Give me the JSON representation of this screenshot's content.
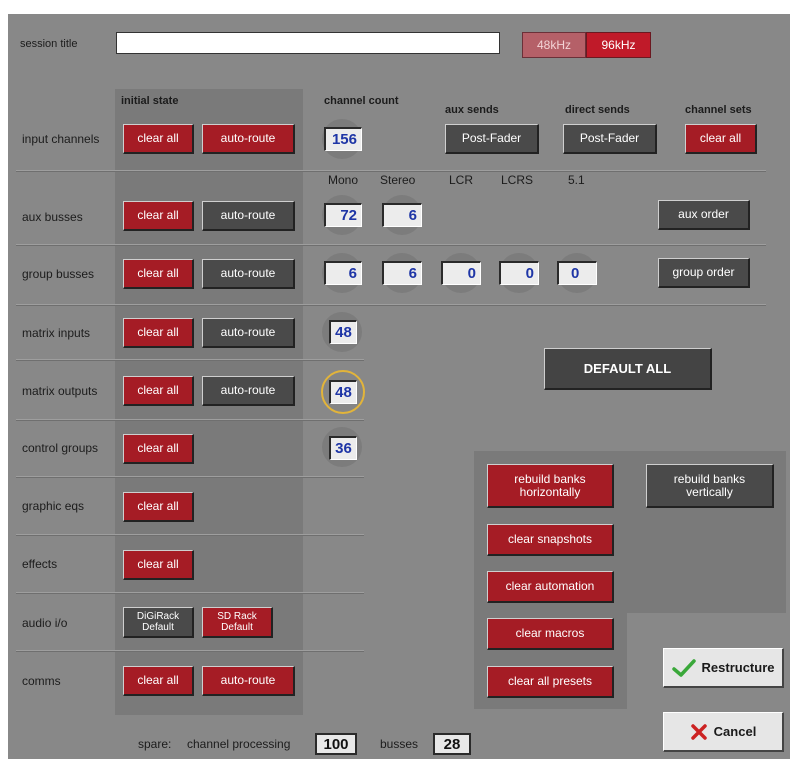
{
  "session": {
    "label": "session title",
    "value": "",
    "rate_48": "48kHz",
    "rate_96": "96kHz"
  },
  "headers": {
    "initial_state": "initial state",
    "channel_count": "channel count",
    "aux_sends": "aux sends",
    "direct_sends": "direct sends",
    "channel_sets": "channel sets"
  },
  "bus_types": [
    "Mono",
    "Stereo",
    "LCR",
    "LCRS",
    "5.1"
  ],
  "rows": {
    "input_channels": "input channels",
    "aux_busses": "aux busses",
    "group_busses": "group busses",
    "matrix_inputs": "matrix inputs",
    "matrix_outputs": "matrix outputs",
    "control_groups": "control groups",
    "graphic_eqs": "graphic eqs",
    "effects": "effects",
    "audio_io": "audio i/o",
    "comms": "comms"
  },
  "buttons": {
    "clear_all": "clear all",
    "auto_route": "auto-route",
    "post_fader": "Post-Fader",
    "aux_order": "aux order",
    "group_order": "group order",
    "default_all": "DEFAULT ALL",
    "digirack_default": "DiGiRack Default",
    "sd_rack_default": "SD Rack Default",
    "rebuild_h": "rebuild banks horizontally",
    "rebuild_v": "rebuild banks vertically",
    "clear_snapshots": "clear snapshots",
    "clear_automation": "clear automation",
    "clear_macros": "clear macros",
    "clear_all_presets": "clear all presets",
    "restructure": "Restructure",
    "cancel": "Cancel"
  },
  "counts": {
    "input_channels": "156",
    "aux_mono": "72",
    "aux_stereo": "6",
    "group_mono": "6",
    "group_stereo": "6",
    "group_lcr": "0",
    "group_lcrs": "0",
    "group_51": "0",
    "matrix_inputs": "48",
    "matrix_outputs": "48",
    "control_groups": "36"
  },
  "spare": {
    "label": "spare:",
    "channel_processing_label": "channel processing",
    "channel_processing": "100",
    "busses_label": "busses",
    "busses": "28"
  },
  "colors": {
    "background": "#888888",
    "red_button": "#a51c25",
    "grey_button": "#4a4a4a",
    "count_text": "#1e35a6",
    "highlight_ring": "#e2b43a"
  }
}
